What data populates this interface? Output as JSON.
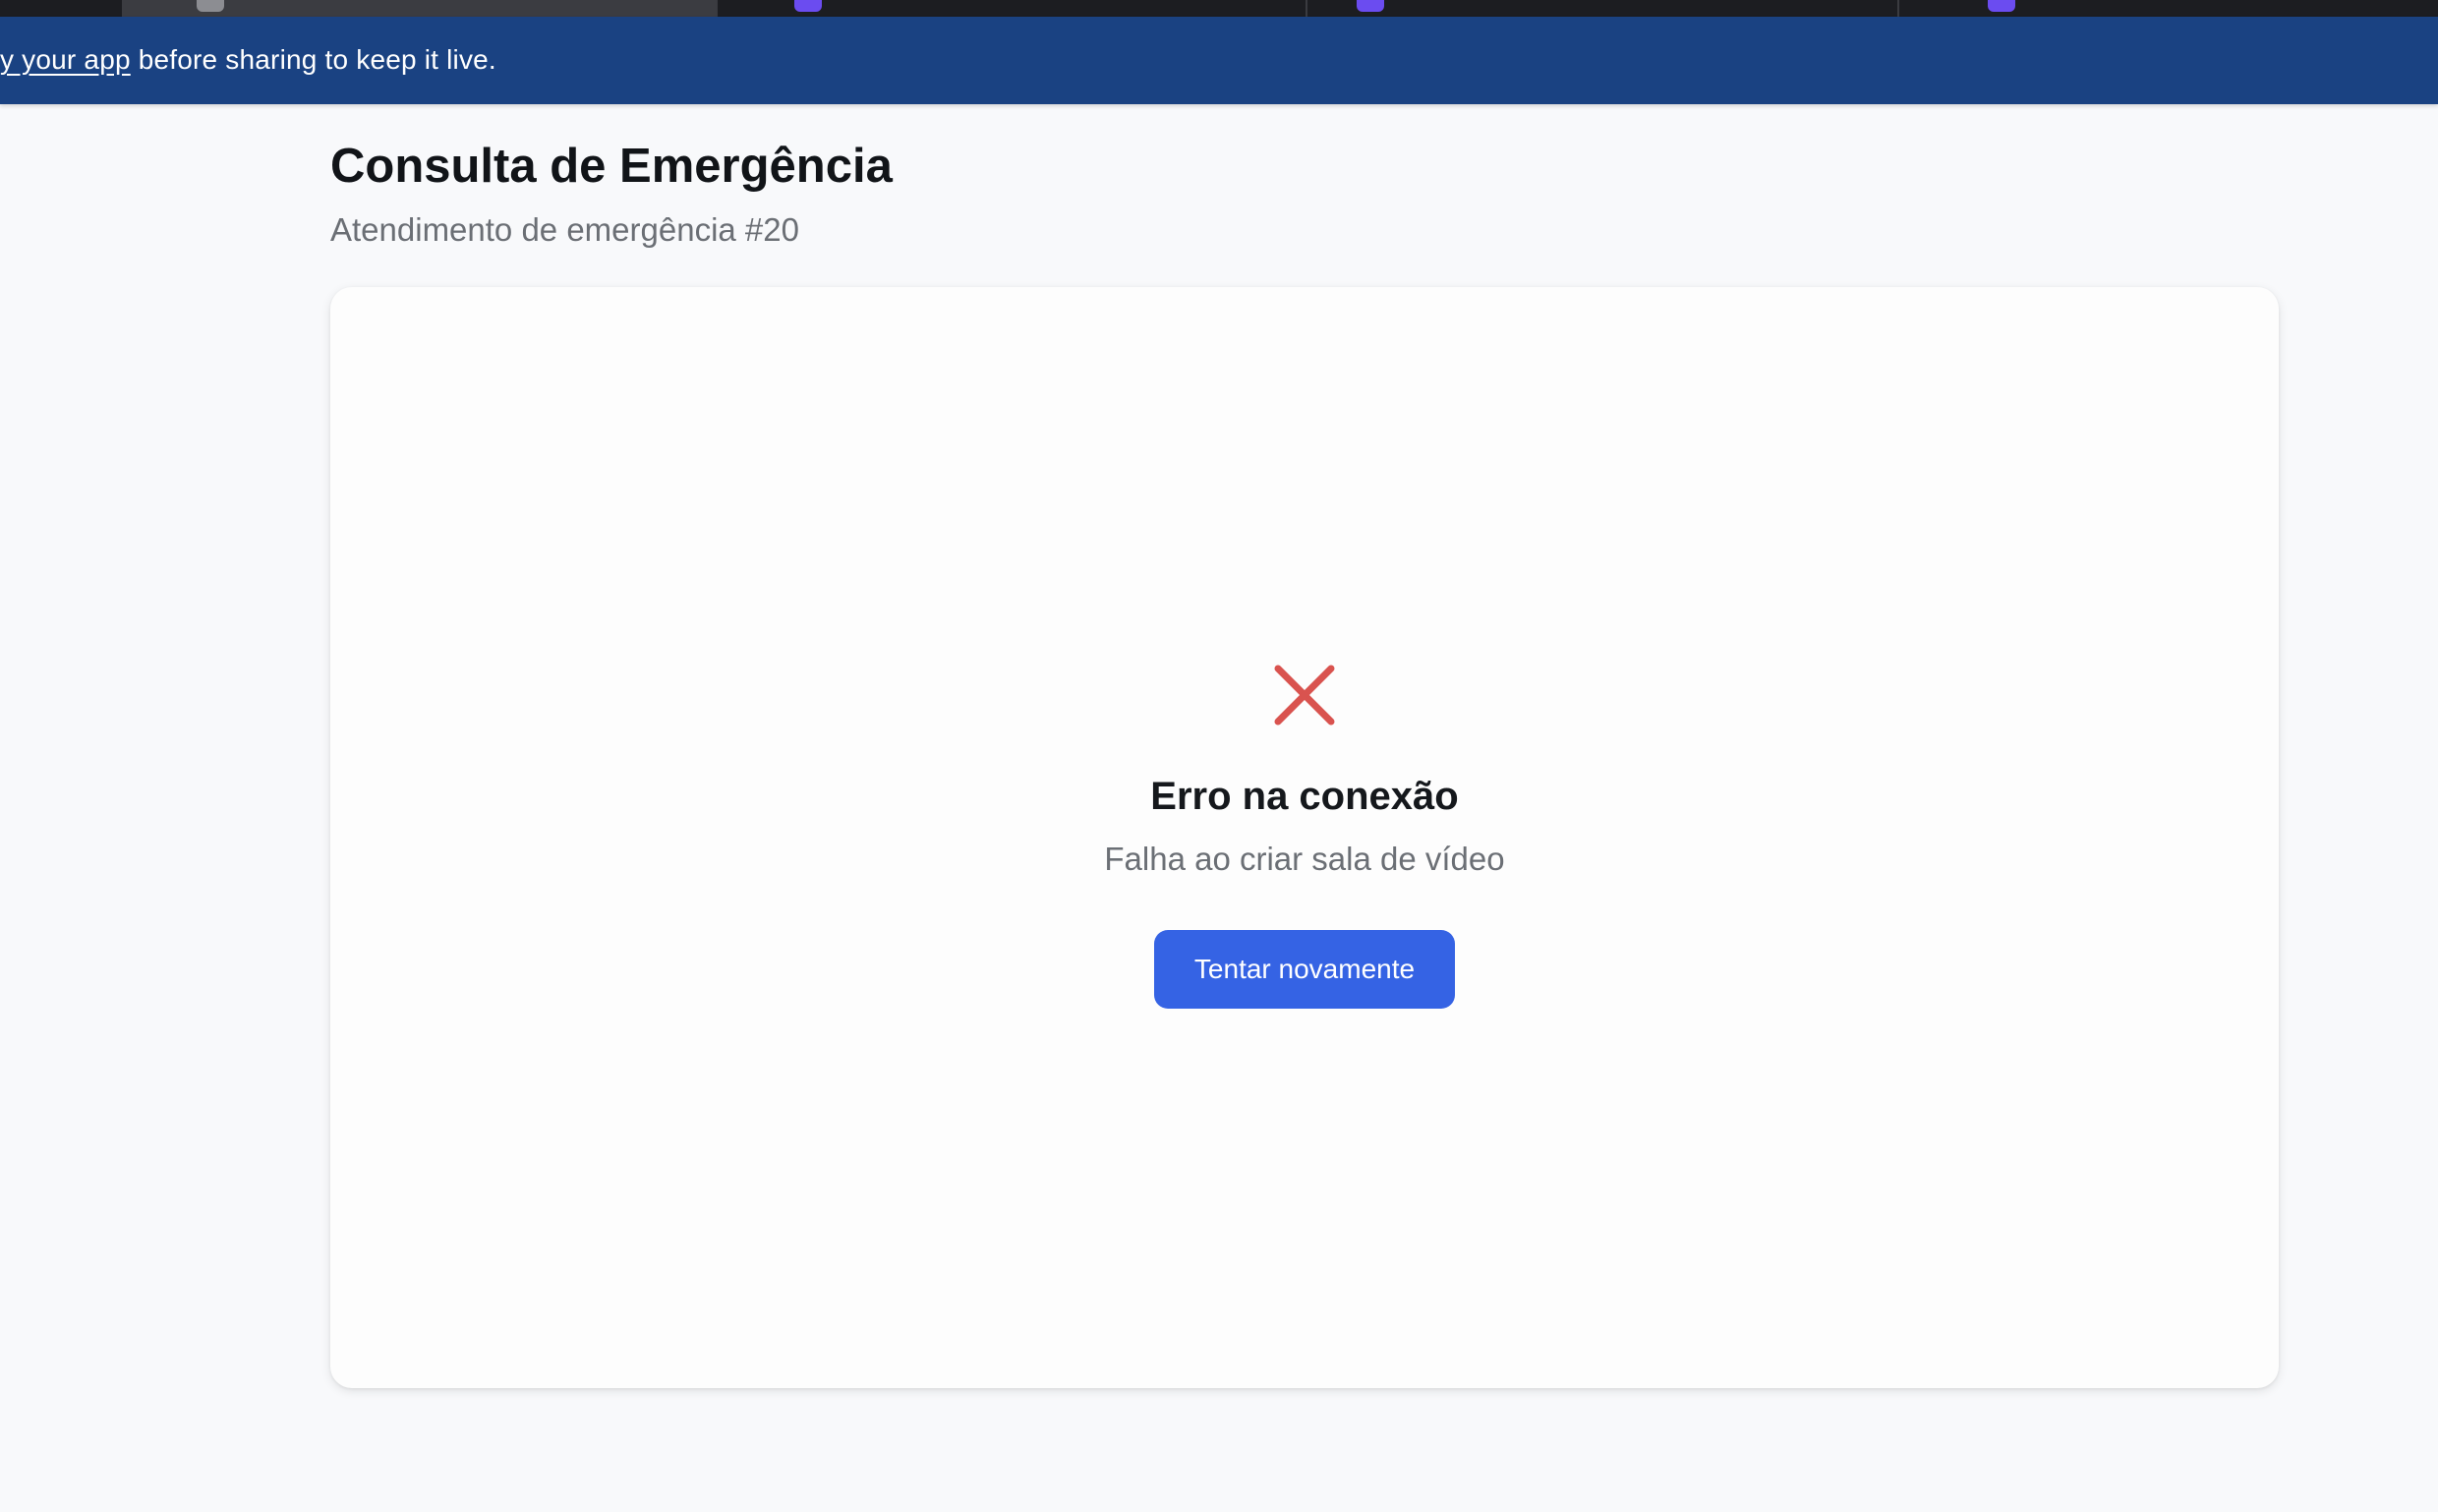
{
  "banner": {
    "link_text": "y your app",
    "text": " before sharing to keep it live."
  },
  "header": {
    "title": "Consulta de Emergência",
    "subtitle": "Atendimento de emergência #20"
  },
  "error": {
    "icon": "close-x-icon",
    "title": "Erro na conexão",
    "message": "Falha ao criar sala de vídeo",
    "retry_label": "Tentar novamente"
  },
  "colors": {
    "banner": "#1a4282",
    "accent": "#3563e4",
    "error_icon": "#d9534f"
  }
}
